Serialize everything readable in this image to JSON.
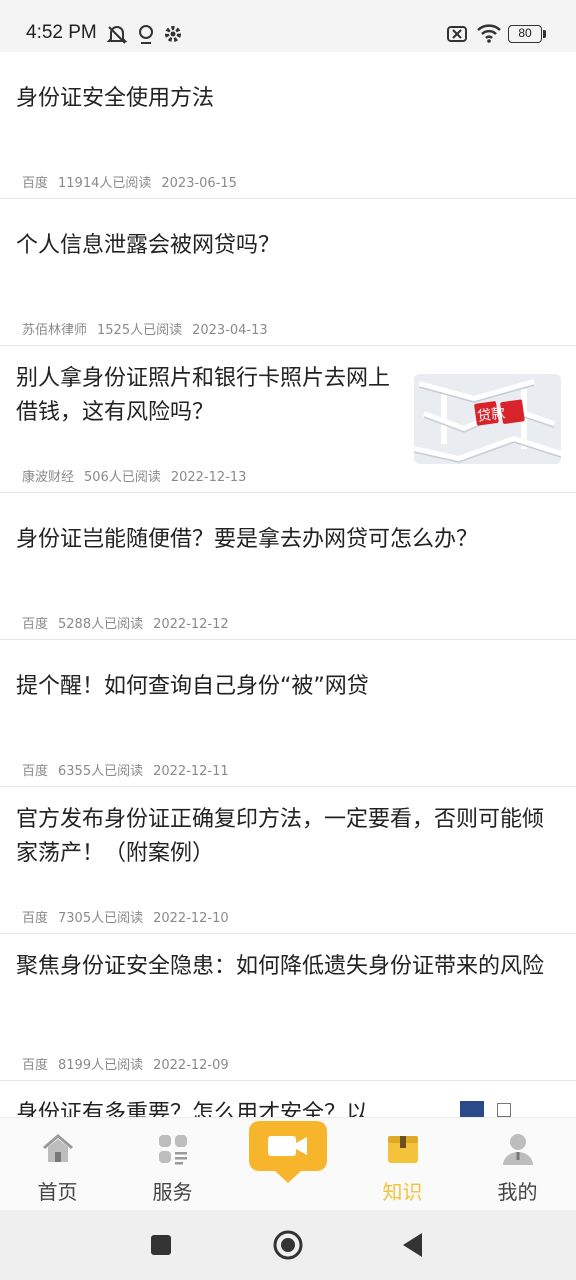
{
  "status_bar": {
    "time": "4:52 PM",
    "battery": "80",
    "icons": [
      "mute-icon",
      "location-icon",
      "gear-icon",
      "sim-off-icon",
      "wifi-icon",
      "battery-icon"
    ]
  },
  "articles": [
    {
      "title": "身份证安全使用方法",
      "source": "百度",
      "reads": "11914人已阅读",
      "date": "2023-06-15"
    },
    {
      "title": "个人信息泄露会被网贷吗？",
      "source": "苏佰林律师",
      "reads": "1525人已阅读",
      "date": "2023-04-13"
    },
    {
      "title": "别人拿身份证照片和银行卡照片去网上借钱，这有风险吗？",
      "source": "康波财经",
      "reads": "506人已阅读",
      "date": "2022-12-13",
      "thumb_text": "贷款"
    },
    {
      "title": "身份证岂能随便借？要是拿去办网贷可怎么办？",
      "source": "百度",
      "reads": "5288人已阅读",
      "date": "2022-12-12"
    },
    {
      "title": "提个醒！如何查询自己身份“被”网贷",
      "source": "百度",
      "reads": "6355人已阅读",
      "date": "2022-12-11"
    },
    {
      "title": "官方发布身份证正确复印方法，一定要看，否则可能倾家荡产！（附案例）",
      "source": "百度",
      "reads": "7305人已阅读",
      "date": "2022-12-10"
    },
    {
      "title": "聚焦身份证安全隐患：如何降低遗失身份证带来的风险",
      "source": "百度",
      "reads": "8199人已阅读",
      "date": "2022-12-09"
    },
    {
      "title": "身份证有多重要？怎么用才安全？以"
    }
  ],
  "tabs": [
    {
      "label": "首页",
      "icon": "home-icon"
    },
    {
      "label": "服务",
      "icon": "services-icon"
    },
    {
      "label": "",
      "icon": "video-camera-icon"
    },
    {
      "label": "知识",
      "icon": "knowledge-box-icon",
      "active": true
    },
    {
      "label": "我的",
      "icon": "profile-icon"
    }
  ],
  "colors": {
    "accent": "#f5c33b",
    "center_button": "#f7b52b",
    "text": "#222222",
    "meta": "#8a8a8a"
  },
  "nav_bar": {
    "buttons": [
      "recents-square-icon",
      "home-circle-icon",
      "back-triangle-icon"
    ]
  }
}
